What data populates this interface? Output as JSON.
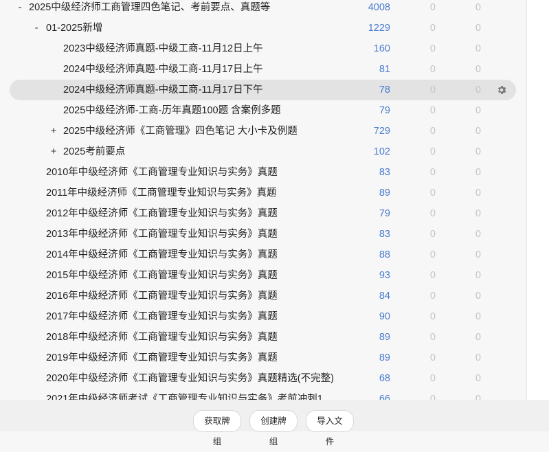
{
  "decks": [
    {
      "toggle": "-",
      "name": "2025中级经济师工商管理四色笔记、考前要点、真题等",
      "new": "4008",
      "learn": "0",
      "due": "0",
      "level": 0
    },
    {
      "toggle": "-",
      "name": "01-2025新增",
      "new": "1229",
      "learn": "0",
      "due": "0",
      "level": 1
    },
    {
      "toggle": "",
      "name": "2023中级经济师真题-中级工商-11月12日上午",
      "new": "160",
      "learn": "0",
      "due": "0",
      "level": 2
    },
    {
      "toggle": "",
      "name": "2024中级经济师真题-中级工商-11月17日上午",
      "new": "81",
      "learn": "0",
      "due": "0",
      "level": 2
    },
    {
      "toggle": "",
      "name": "2024中级经济师真题-中级工商-11月17日下午",
      "new": "78",
      "learn": "0",
      "due": "0",
      "level": 2,
      "selected": true
    },
    {
      "toggle": "",
      "name": "2025中级经济师-工商-历年真题100题 含案例多题",
      "new": "79",
      "learn": "0",
      "due": "0",
      "level": 2
    },
    {
      "toggle": "+",
      "name": "2025中级经济师《工商管理》四色笔记 大小卡及例题",
      "new": "729",
      "learn": "0",
      "due": "0",
      "level": 2
    },
    {
      "toggle": "+",
      "name": "2025考前要点",
      "new": "102",
      "learn": "0",
      "due": "0",
      "level": 2
    },
    {
      "toggle": "",
      "name": "2010年中级经济师《工商管理专业知识与实务》真题",
      "new": "83",
      "learn": "0",
      "due": "0",
      "level": 1
    },
    {
      "toggle": "",
      "name": "2011年中级经济师《工商管理专业知识与实务》真题",
      "new": "89",
      "learn": "0",
      "due": "0",
      "level": 1
    },
    {
      "toggle": "",
      "name": "2012年中级经济师《工商管理专业知识与实务》真题",
      "new": "79",
      "learn": "0",
      "due": "0",
      "level": 1
    },
    {
      "toggle": "",
      "name": "2013年中级经济师《工商管理专业知识与实务》真题",
      "new": "83",
      "learn": "0",
      "due": "0",
      "level": 1
    },
    {
      "toggle": "",
      "name": "2014年中级经济师《工商管理专业知识与实务》真题",
      "new": "88",
      "learn": "0",
      "due": "0",
      "level": 1
    },
    {
      "toggle": "",
      "name": "2015年中级经济师《工商管理专业知识与实务》真题",
      "new": "93",
      "learn": "0",
      "due": "0",
      "level": 1
    },
    {
      "toggle": "",
      "name": "2016年中级经济师《工商管理专业知识与实务》真题",
      "new": "84",
      "learn": "0",
      "due": "0",
      "level": 1
    },
    {
      "toggle": "",
      "name": "2017年中级经济师《工商管理专业知识与实务》真题",
      "new": "90",
      "learn": "0",
      "due": "0",
      "level": 1
    },
    {
      "toggle": "",
      "name": "2018年中级经济师《工商管理专业知识与实务》真题",
      "new": "89",
      "learn": "0",
      "due": "0",
      "level": 1
    },
    {
      "toggle": "",
      "name": "2019年中级经济师《工商管理专业知识与实务》真题",
      "new": "89",
      "learn": "0",
      "due": "0",
      "level": 1
    },
    {
      "toggle": "",
      "name": "2020年中级经济师《工商管理专业知识与实务》真题精选(不完整)",
      "new": "68",
      "learn": "0",
      "due": "0",
      "level": 1
    },
    {
      "toggle": "",
      "name": "2021年中级经济师考试《工商管理专业知识与实务》考前冲刺1",
      "new": "66",
      "learn": "0",
      "due": "0",
      "level": 1
    }
  ],
  "icons": {
    "options": "gear-icon"
  },
  "colors": {
    "new_count": "#4a7bd0",
    "zero_count": "#c4c4c4",
    "selected_row": "#e3e3e3"
  },
  "bottom_bar": {
    "get_decks": "获取牌组",
    "create_deck": "创建牌组",
    "import_file": "导入文件"
  }
}
